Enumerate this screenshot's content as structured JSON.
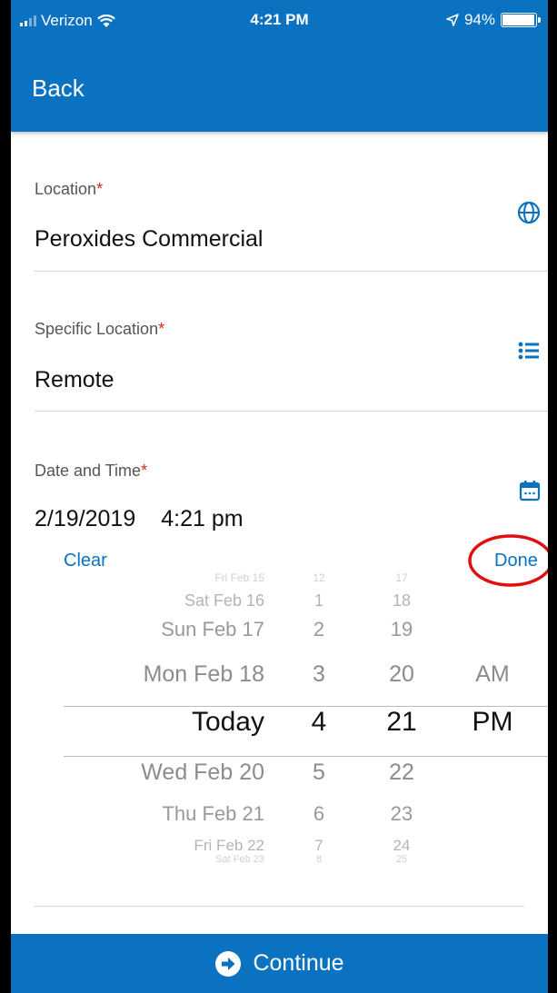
{
  "status_bar": {
    "carrier": "Verizon",
    "time": "4:21 PM",
    "battery": "94%"
  },
  "nav": {
    "back_label": "Back"
  },
  "fields": {
    "location": {
      "label": "Location",
      "required": "*",
      "value": "Peroxides Commercial",
      "icon": "globe-icon"
    },
    "specific_location": {
      "label": "Specific Location",
      "required": "*",
      "value": "Remote",
      "icon": "list-icon"
    },
    "date_time": {
      "label": "Date and Time",
      "required": "*",
      "date": "2/19/2019",
      "time": "4:21 pm",
      "icon": "calendar-icon"
    }
  },
  "picker_actions": {
    "clear": "Clear",
    "done": "Done"
  },
  "picker": {
    "days": [
      "Fri Feb 15",
      "Sat Feb 16",
      "Sun Feb 17",
      "Mon Feb 18",
      "Today",
      "Wed Feb 20",
      "Thu Feb 21",
      "Fri Feb 22",
      "Sat Feb 23"
    ],
    "hours": [
      "12",
      "1",
      "2",
      "3",
      "4",
      "5",
      "6",
      "7",
      "8"
    ],
    "minutes": [
      "17",
      "18",
      "19",
      "20",
      "21",
      "22",
      "23",
      "24",
      "25"
    ],
    "ampm": [
      "AM",
      "PM"
    ],
    "selected_index": 4
  },
  "footer": {
    "continue_label": "Continue"
  },
  "colors": {
    "accent": "#0b72c1",
    "required": "#d8231f",
    "annotation": "#e01010"
  }
}
